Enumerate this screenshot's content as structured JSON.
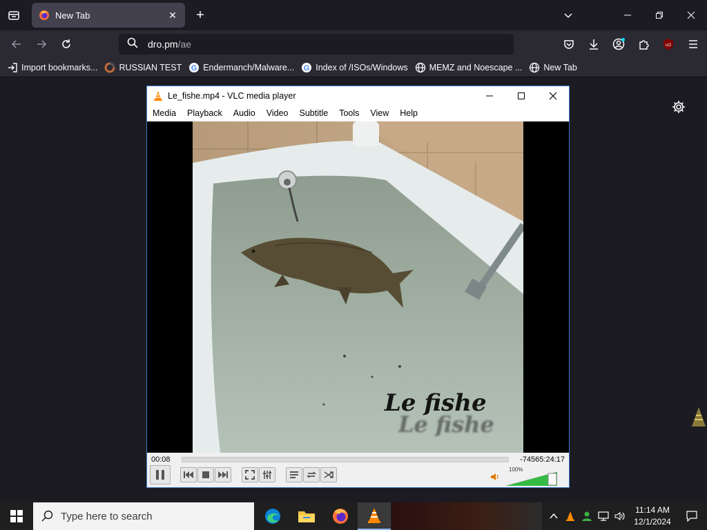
{
  "browser": {
    "tab": {
      "title": "New Tab"
    },
    "url": {
      "host": "dro.pm",
      "path": "/ae"
    },
    "bookmarks": [
      {
        "label": "Import bookmarks...",
        "icon": "import-icon"
      },
      {
        "label": "RUSSIAN TEST",
        "icon": "site-icon"
      },
      {
        "label": "Endermanch/Malware...",
        "icon": "google-icon"
      },
      {
        "label": "Index of /ISOs/Windows",
        "icon": "google-icon"
      },
      {
        "label": "MEMZ and Noescape ...",
        "icon": "globe-icon"
      },
      {
        "label": "New Tab",
        "icon": "globe-icon"
      }
    ]
  },
  "vlc": {
    "title": "Le_fishe.mp4 - VLC media player",
    "menu": [
      "Media",
      "Playback",
      "Audio",
      "Video",
      "Subtitle",
      "Tools",
      "View",
      "Help"
    ],
    "video": {
      "caption": "Le fishe"
    },
    "elapsed": "00:08",
    "remaining": "-74565:24:17",
    "volume_label": "100%",
    "volume": 1.0,
    "progress": 0.0
  },
  "taskbar": {
    "search_placeholder": "Type here to search",
    "time": "11:14 AM",
    "date": "12/1/2024"
  },
  "colors": {
    "chrome_bg": "#1c1b22",
    "toolbar_bg": "#2b2a33",
    "tab_active": "#42414d",
    "vlc_orange": "#ff8800",
    "volume_green": "#2ea043"
  }
}
